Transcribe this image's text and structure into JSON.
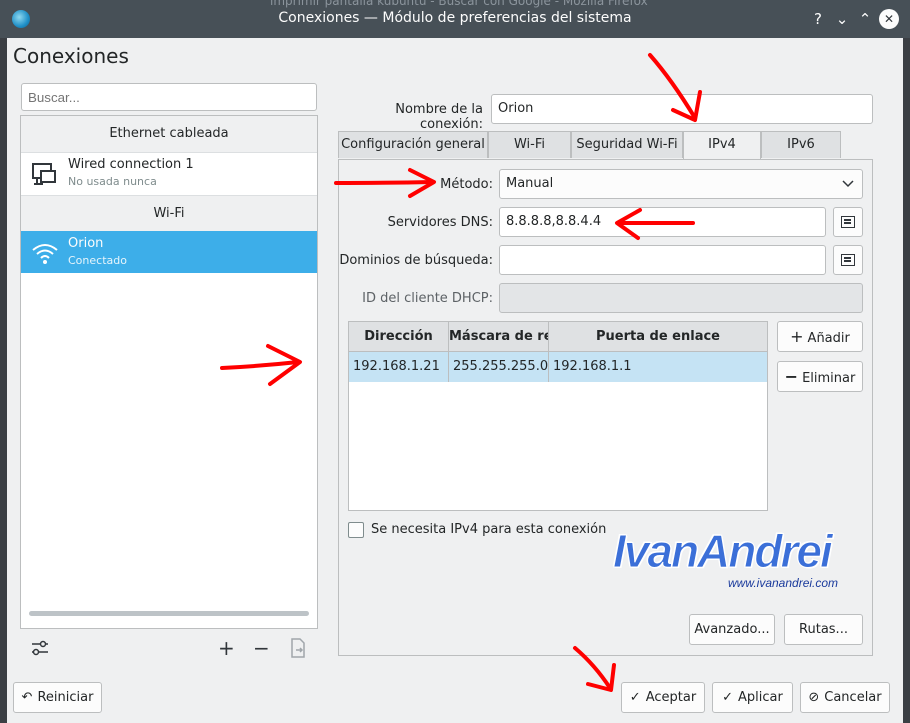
{
  "titlebar": {
    "title": "Conexiones — Módulo de preferencias del sistema",
    "background_window_text": "imprimir pantalla kubuntu - Buscar con Google - Mozilla Firefox",
    "help_glyph": "?",
    "minimize_glyph": "⌄",
    "maximize_glyph": "⌃",
    "close_glyph": "✕"
  },
  "window": {
    "heading": "Conexiones"
  },
  "sidebar": {
    "search_placeholder": "Buscar...",
    "sections": [
      {
        "header": "Ethernet cableada",
        "items": [
          {
            "name": "Wired connection 1",
            "status": "No usada nunca",
            "icon": "wired-network-icon",
            "selected": false
          }
        ]
      },
      {
        "header": "Wi-Fi",
        "items": [
          {
            "name": "Orion",
            "status": "Conectado",
            "icon": "wifi-signal-icon",
            "selected": true
          }
        ]
      }
    ],
    "tools": {
      "configure": "configure-icon",
      "add": "+",
      "remove": "−",
      "export": "export-icon"
    }
  },
  "form": {
    "connection_name_label": "Nombre de la conexión:",
    "connection_name_value": "Orion",
    "tabs": [
      "Configuración general",
      "Wi-Fi",
      "Seguridad Wi-Fi",
      "IPv4",
      "IPv6"
    ],
    "active_tab": "IPv4",
    "method_label": "Método:",
    "method_value": "Manual",
    "dns_label": "Servidores DNS:",
    "dns_value": "8.8.8.8,8.8.4.4",
    "search_domains_label": "Dominios de búsqueda:",
    "search_domains_value": "",
    "dhcp_client_id_label": "ID del cliente DHCP:",
    "dhcp_client_id_value": "",
    "address_table": {
      "columns": [
        "Dirección",
        "Máscara de red",
        "Puerta de enlace"
      ],
      "rows": [
        [
          "192.168.1.21",
          "255.255.255.0",
          "192.168.1.1"
        ]
      ]
    },
    "add_button": "Añadir",
    "remove_button": "Eliminar",
    "ipv4_required_label": "Se necesita IPv4 para esta conexión",
    "ipv4_required_checked": false,
    "advanced_button": "Avanzado...",
    "routes_button": "Rutas..."
  },
  "watermark": {
    "main": "IvanAndrei",
    "url": "www.ivanandrei.com"
  },
  "footer": {
    "reset_button": "Reiniciar",
    "accept_button": "Aceptar",
    "apply_button": "Aplicar",
    "cancel_button": "Cancelar"
  },
  "colors": {
    "selection": "#3daee9",
    "titlebar": "#475057",
    "annotation_arrows": "#ff0000",
    "table_row_highlight": "#c5e3f4"
  }
}
